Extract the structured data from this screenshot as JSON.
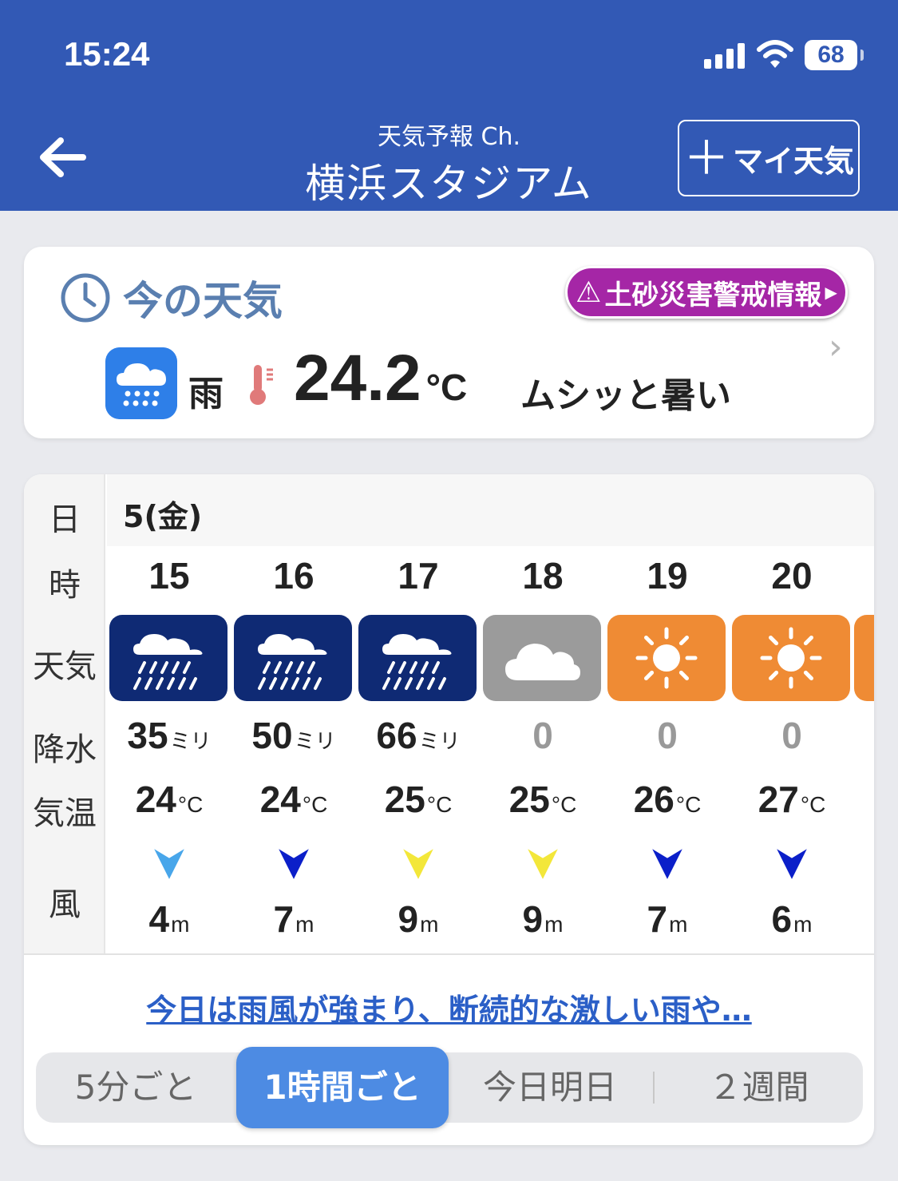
{
  "status_bar": {
    "time": "15:24",
    "battery": "68"
  },
  "header": {
    "subtitle": "天気予報 Ch.",
    "title": "横浜スタジアム",
    "my_weather_label": "マイ天気"
  },
  "now": {
    "title": "今の天気",
    "warning_label": "土砂災害警戒情報",
    "weather": "雨",
    "temperature": "24.2",
    "temperature_unit": "°C",
    "feel": "ムシッと暑い"
  },
  "forecast": {
    "row_labels": {
      "date": "日",
      "hour": "時",
      "weather": "天気",
      "precip": "降水",
      "temp": "気温",
      "wind": "風"
    },
    "date": "5(金)",
    "precip_unit": "ミリ",
    "temp_unit": "°C",
    "wind_unit": "m",
    "hours": [
      {
        "hour": "15",
        "weather": "heavy-rain",
        "precip": "35",
        "temp": "24",
        "wind": "4",
        "wind_color": "#48a6ea"
      },
      {
        "hour": "16",
        "weather": "heavy-rain",
        "precip": "50",
        "temp": "24",
        "wind": "7",
        "wind_color": "#0b1fc9"
      },
      {
        "hour": "17",
        "weather": "heavy-rain",
        "precip": "66",
        "temp": "25",
        "wind": "9",
        "wind_color": "#f3e73a"
      },
      {
        "hour": "18",
        "weather": "cloudy",
        "precip": "0",
        "temp": "25",
        "wind": "9",
        "wind_color": "#f3e73a"
      },
      {
        "hour": "19",
        "weather": "sunny",
        "precip": "0",
        "temp": "26",
        "wind": "7",
        "wind_color": "#0b1fc9"
      },
      {
        "hour": "20",
        "weather": "sunny",
        "precip": "0",
        "temp": "27",
        "wind": "6",
        "wind_color": "#0b1fc9"
      }
    ],
    "summary": "今日は雨風が強まり、断続的な激しい雨や…",
    "tabs": [
      "5分ごと",
      "1時間ごと",
      "今日明日",
      "２週間"
    ],
    "active_tab": "1時間ごと"
  },
  "colors": {
    "header": "#3259b5",
    "heavy_rain": "#0f2a74",
    "cloudy": "#9b9b9b",
    "sunny": "#ef8b34",
    "warning": "#a526a6",
    "now_icon": "#2e7fe8"
  }
}
